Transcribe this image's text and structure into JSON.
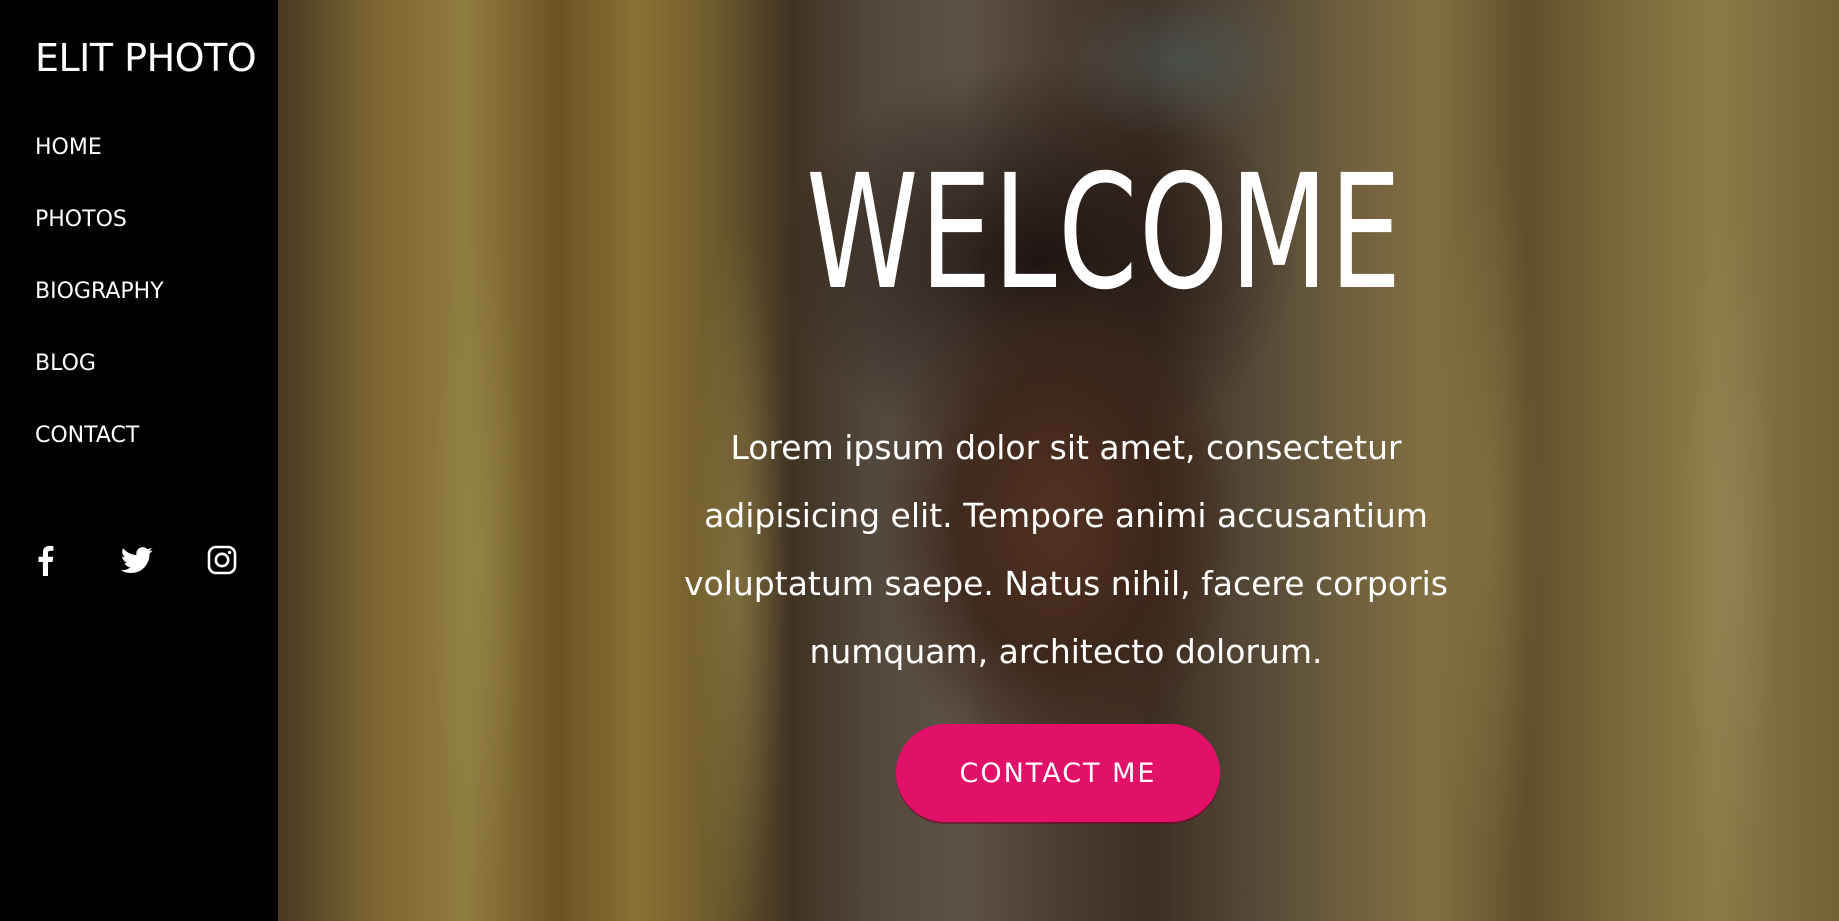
{
  "brand": {
    "logo": "ELIT PHOTO"
  },
  "nav": {
    "items": [
      {
        "label": "HOME"
      },
      {
        "label": "PHOTOS"
      },
      {
        "label": "BIOGRAPHY"
      },
      {
        "label": "BLOG"
      },
      {
        "label": "CONTACT"
      }
    ]
  },
  "social": {
    "icons": [
      "facebook-icon",
      "twitter-icon",
      "instagram-icon"
    ]
  },
  "hero": {
    "title": "WELCOME",
    "text": "Lorem ipsum dolor sit amet, consectetur adipisicing elit. Tempore animi accusantium voluptatum saepe. Natus nihil, facere corporis numquam, architecto dolorum.",
    "cta_label": "CONTACT ME"
  },
  "colors": {
    "sidebar_bg": "#000000",
    "accent": "#e3106a",
    "text": "#ffffff"
  }
}
